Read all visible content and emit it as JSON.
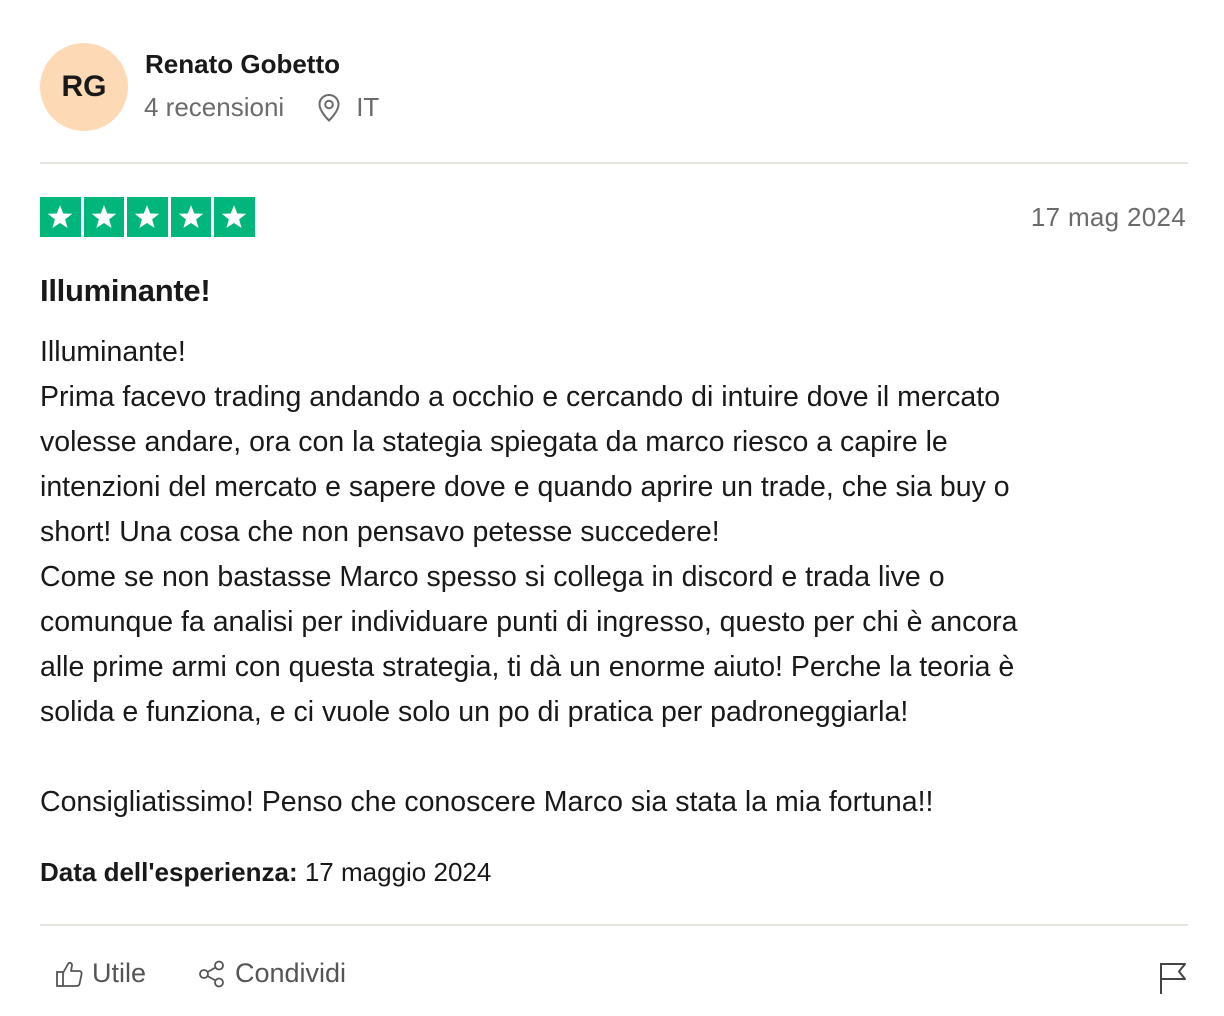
{
  "reviewer": {
    "initials": "RG",
    "name": "Renato Gobetto",
    "reviews_count": "4 recensioni",
    "country": "IT"
  },
  "rating": {
    "stars": 5,
    "max_stars": 5,
    "color": "#00b67a"
  },
  "date": "17 mag 2024",
  "review": {
    "title": "Illuminante!",
    "lines": [
      "Illuminante!",
      "Prima facevo trading andando a occhio e cercando di intuire dove il mercato",
      "volesse andare, ora con la stategia spiegata da marco riesco a capire le",
      "intenzioni del mercato e sapere dove e quando aprire un trade, che sia buy o",
      "short! Una cosa che non pensavo petesse succedere!",
      "Come se non bastasse Marco spesso si collega in discord e trada live o",
      "comunque fa analisi per individuare punti di ingresso, questo per chi è ancora",
      "alle prime armi con questa strategia, ti dà un enorme aiuto! Perche la teoria è",
      "solida e funziona, e ci vuole solo un po di pratica per padroneggiarla!",
      "Consigliatissimo! Penso che conoscere Marco sia stata la mia fortuna!!"
    ]
  },
  "experience": {
    "label": "Data dell'esperienza:",
    "value": " 17 maggio 2024"
  },
  "actions": {
    "useful": "Utile",
    "share": "Condividi"
  },
  "icons": {
    "location": "location-pin-icon",
    "star": "star-icon",
    "useful": "thumbs-up-icon",
    "share": "share-icon",
    "report": "flag-icon"
  },
  "colors": {
    "avatar_bg": "#fdd9b5",
    "star_green": "#00b67a",
    "muted_text": "#6b6b6b"
  }
}
